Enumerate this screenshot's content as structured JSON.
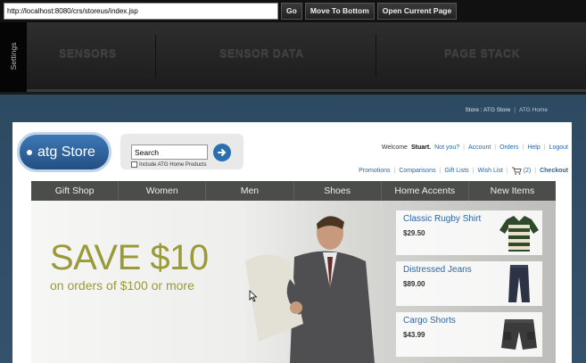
{
  "toolbar": {
    "url": "http://localhost:8080/crs/storeus/index.jsp",
    "go_label": "Go",
    "move_label": "Move To Bottom",
    "open_label": "Open Current Page"
  },
  "devpanel": {
    "settings_label": "Settings",
    "sections": [
      "SENSORS",
      "SENSOR DATA",
      "PAGE STACK"
    ]
  },
  "breadcrumb": {
    "store": "Store : ATG Store",
    "separator": "|",
    "home": "ATG Home"
  },
  "store": {
    "logo_text": "atg Store",
    "search_value": "Search",
    "include_label": "Include ATG Home Products",
    "welcome_prefix": "Welcome",
    "user_name": "Stuart.",
    "not_you": "Not you?",
    "account": "Account",
    "orders": "Orders",
    "help": "Help",
    "logout": "Logout",
    "promotions": "Promotions",
    "comparisons": "Comparisons",
    "gift_lists": "Gift Lists",
    "wish_list": "Wish List",
    "cart_count": "(2)",
    "checkout": "Checkout"
  },
  "nav": [
    "Gift Shop",
    "Women",
    "Men",
    "Shoes",
    "Home Accents",
    "New Items"
  ],
  "hero": {
    "headline": "SAVE $10",
    "subline": "on orders of $100 or more"
  },
  "products": [
    {
      "name": "Classic Rugby Shirt",
      "price": "$29.50"
    },
    {
      "name": "Distressed Jeans",
      "price": "$89.00"
    },
    {
      "name": "Cargo Shorts",
      "price": "$43.99"
    }
  ],
  "colors": {
    "accent_blue": "#2a66a8",
    "hero_green": "#9a9a3a",
    "nav_bg": "#4a4d4a"
  }
}
